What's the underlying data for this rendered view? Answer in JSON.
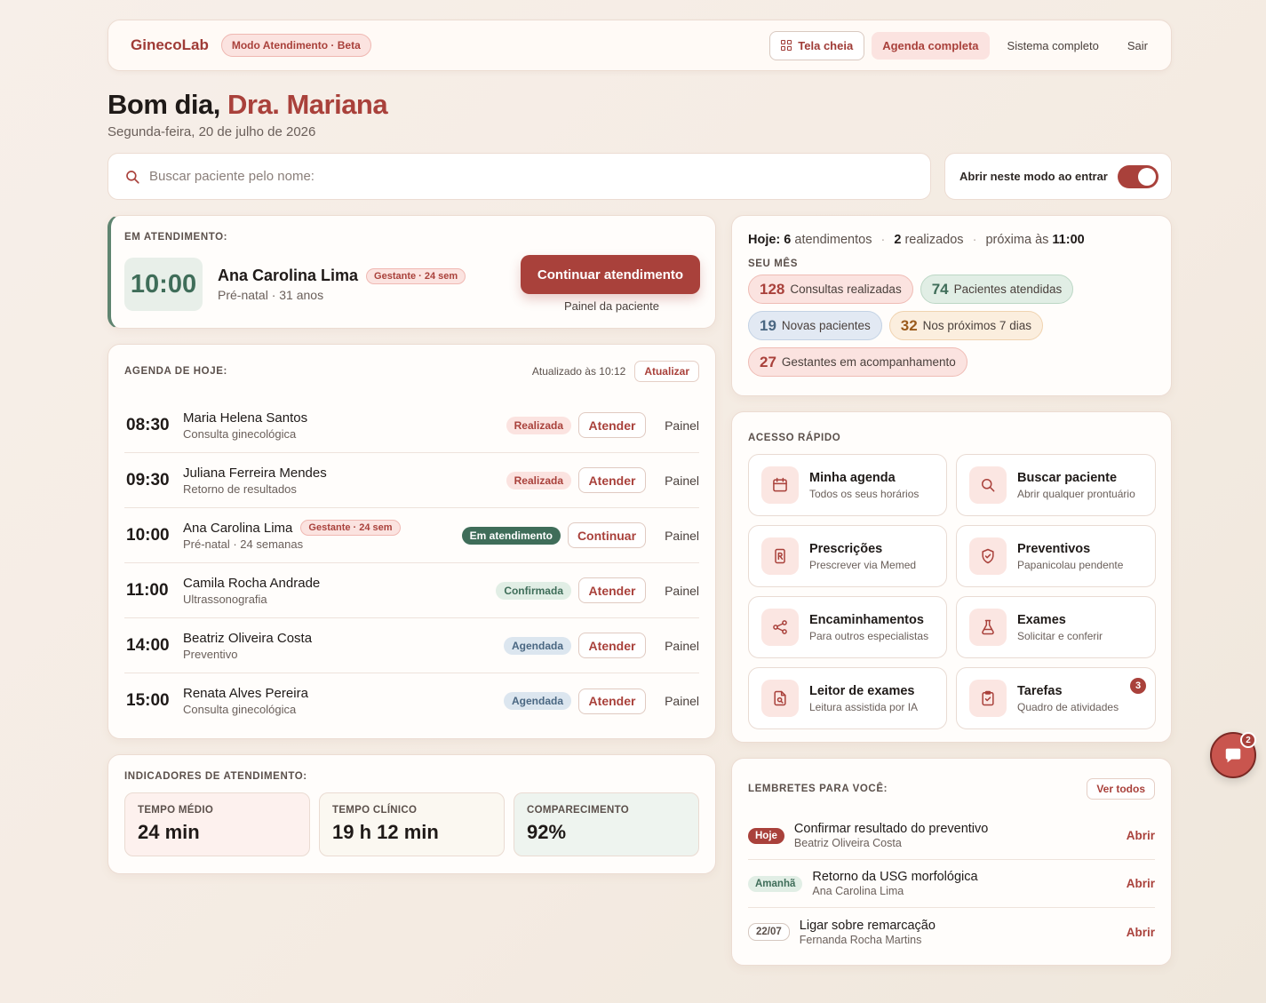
{
  "header": {
    "brand": "GinecoLab",
    "mode_badge": "Modo Atendimento · Beta",
    "fullscreen": "Tela cheia",
    "agenda_completa": "Agenda completa",
    "sistema_completo": "Sistema completo",
    "sair": "Sair"
  },
  "greeting": {
    "prefix": "Bom dia,",
    "name": "Dra. Mariana",
    "date": "Segunda-feira, 20 de julho de 2026"
  },
  "search": {
    "placeholder": "Buscar paciente pelo nome:",
    "value": ""
  },
  "toggle": {
    "label": "Abrir neste modo ao entrar",
    "on": true
  },
  "current": {
    "label": "EM ATENDIMENTO:",
    "time": "10:00",
    "name": "Ana Carolina Lima",
    "tag": "Gestante · 24 sem",
    "sub": "Pré-natal · 31 anos",
    "continue_btn": "Continuar atendimento",
    "panel_link": "Painel da paciente"
  },
  "agenda": {
    "label": "AGENDA DE HOJE:",
    "updated": "Atualizado às 10:12",
    "refresh": "Atualizar",
    "rows": [
      {
        "time": "08:30",
        "name": "Maria Helena Santos",
        "sub": "Consulta ginecológica",
        "status": "Realizada",
        "action": "Atender",
        "panel": "Painel"
      },
      {
        "time": "09:30",
        "name": "Juliana Ferreira Mendes",
        "sub": "Retorno de resultados",
        "status": "Realizada",
        "action": "Atender",
        "panel": "Painel"
      },
      {
        "time": "10:00",
        "name": "Ana Carolina Lima",
        "tag": "Gestante · 24 sem",
        "sub": "Pré-natal · 24 semanas",
        "status": "Em atendimento",
        "action": "Continuar",
        "panel": "Painel"
      },
      {
        "time": "11:00",
        "name": "Camila Rocha Andrade",
        "sub": "Ultrassonografia",
        "status": "Confirmada",
        "action": "Atender",
        "panel": "Painel"
      },
      {
        "time": "14:00",
        "name": "Beatriz Oliveira Costa",
        "sub": "Preventivo",
        "status": "Agendada",
        "action": "Atender",
        "panel": "Painel"
      },
      {
        "time": "15:00",
        "name": "Renata Alves Pereira",
        "sub": "Consulta ginecológica",
        "status": "Agendada",
        "action": "Atender",
        "panel": "Painel"
      }
    ]
  },
  "indicators": {
    "label": "INDICADORES DE ATENDIMENTO:",
    "items": [
      {
        "key": "TEMPO MÉDIO",
        "value": "24 min"
      },
      {
        "key": "TEMPO CLÍNICO",
        "value": "19 h 12 min"
      },
      {
        "key": "COMPARECIMENTO",
        "value": "92%"
      }
    ]
  },
  "today": {
    "hoje_label": "Hoje:",
    "appointments": "6",
    "appointments_label": "atendimentos",
    "done": "2",
    "done_label": "realizados",
    "next_label": "próxima às",
    "next_time": "11:00",
    "month_label": "SEU MÊS",
    "pills": [
      {
        "value": "128",
        "label": "Consultas realizadas",
        "color": "red"
      },
      {
        "value": "74",
        "label": "Pacientes atendidas",
        "color": "green"
      },
      {
        "value": "19",
        "label": "Novas pacientes",
        "color": "blue"
      },
      {
        "value": "32",
        "label": "Nos próximos 7 dias",
        "color": "yellow"
      },
      {
        "value": "27",
        "label": "Gestantes em acompanhamento",
        "color": "red"
      }
    ]
  },
  "quick": {
    "label": "ACESSO RÁPIDO",
    "items": [
      {
        "title": "Minha agenda",
        "sub": "Todos os seus horários",
        "icon": "calendar-icon"
      },
      {
        "title": "Buscar paciente",
        "sub": "Abrir qualquer prontuário",
        "icon": "search-icon"
      },
      {
        "title": "Prescrições",
        "sub": "Prescrever via Memed",
        "icon": "prescription-icon"
      },
      {
        "title": "Preventivos",
        "sub": "Papanicolau pendente",
        "icon": "shield-check-icon"
      },
      {
        "title": "Encaminhamentos",
        "sub": "Para outros especialistas",
        "icon": "share-icon"
      },
      {
        "title": "Exames",
        "sub": "Solicitar e conferir",
        "icon": "flask-icon"
      },
      {
        "title": "Leitor de exames",
        "sub": "Leitura assistida por IA",
        "icon": "document-search-icon"
      },
      {
        "title": "Tarefas",
        "sub": "Quadro de atividades",
        "icon": "clipboard-icon",
        "badge": "3"
      }
    ]
  },
  "reminders": {
    "label": "LEMBRETES PARA VOCÊ:",
    "see_all": "Ver todos",
    "items": [
      {
        "tag": "Hoje",
        "title": "Confirmar resultado do preventivo",
        "sub": "Beatriz Oliveira Costa",
        "action": "Abrir"
      },
      {
        "tag": "Amanhã",
        "title": "Retorno da USG morfológica",
        "sub": "Ana Carolina Lima",
        "action": "Abrir"
      },
      {
        "tag": "22/07",
        "title": "Ligar sobre remarcação",
        "sub": "Fernanda Rocha Martins",
        "action": "Abrir"
      }
    ]
  },
  "chat": {
    "count": "2",
    "icon": "chat-icon"
  },
  "colors": {
    "accent": "#a9413b",
    "green": "#3f6d59",
    "background": "#f5ede5"
  }
}
